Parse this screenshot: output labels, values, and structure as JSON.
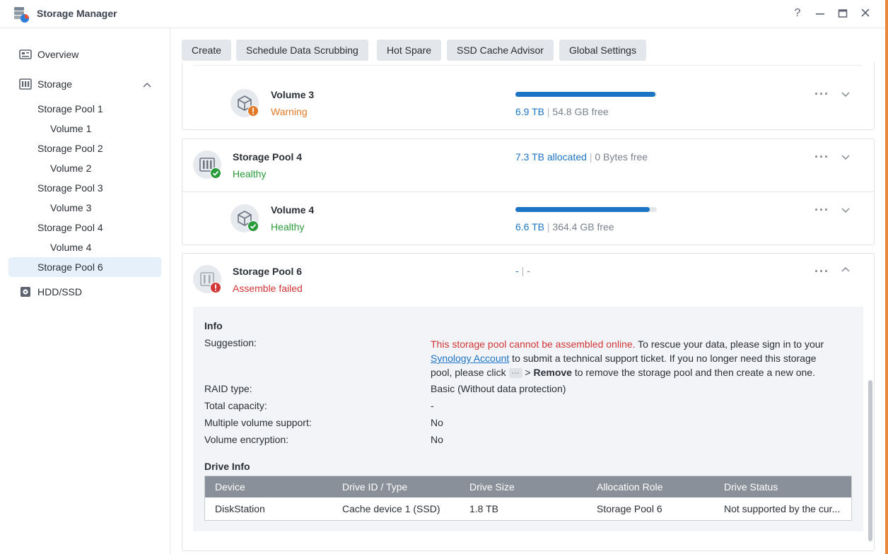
{
  "app": {
    "title": "Storage Manager",
    "window_buttons": {
      "help": "?",
      "minimize": "—",
      "maximize": "□",
      "close": "✕"
    }
  },
  "sidebar": {
    "overview": "Overview",
    "storage": "Storage",
    "items": [
      {
        "label": "Storage Pool 1"
      },
      {
        "label": "Volume 1"
      },
      {
        "label": "Storage Pool 2"
      },
      {
        "label": "Volume 2"
      },
      {
        "label": "Storage Pool 3"
      },
      {
        "label": "Volume 3"
      },
      {
        "label": "Storage Pool 4"
      },
      {
        "label": "Volume 4"
      },
      {
        "label": "Storage Pool 6"
      }
    ],
    "hdd": "HDD/SSD"
  },
  "toolbar": {
    "create": "Create",
    "scrubbing": "Schedule Data Scrubbing",
    "hot_spare": "Hot Spare",
    "cache_advisor": "SSD Cache Advisor",
    "global_settings": "Global Settings"
  },
  "volume3": {
    "name": "Volume 3",
    "status": "Warning",
    "used": "6.9 TB",
    "sep": "|",
    "free": "54.8 GB free",
    "usage": 0.99
  },
  "pool4": {
    "name": "Storage Pool 4",
    "status": "Healthy",
    "allocated": "7.3 TB allocated",
    "sep": "|",
    "free": "0 Bytes free"
  },
  "volume4": {
    "name": "Volume 4",
    "status": "Healthy",
    "used": "6.6 TB",
    "sep": "|",
    "free": "364.4 GB free",
    "usage": 0.95
  },
  "pool6": {
    "name": "Storage Pool 6",
    "status": "Assemble failed",
    "capacity_a": "-",
    "sep": "|",
    "capacity_b": "-",
    "info": {
      "heading": "Info",
      "suggestion_label": "Suggestion:",
      "suggestion_error": "This storage pool cannot be assembled online.",
      "suggestion_1": " To rescue your data, please sign in to your",
      "suggestion_link": "Synology Account",
      "suggestion_2": " to submit a technical support ticket. If you no longer need this storage",
      "suggestion_3": "pool, please click",
      "suggestion_dots": "···",
      "suggestion_4": " > ",
      "suggestion_remove": "Remove",
      "suggestion_5": " to remove the storage pool and then create a new one.",
      "raid_label": "RAID type:",
      "raid_value": "Basic (Without data protection)",
      "capacity_label": "Total capacity:",
      "capacity_value": "-",
      "multi_label": "Multiple volume support:",
      "multi_value": "No",
      "enc_label": "Volume encryption:",
      "enc_value": "No"
    },
    "drive_info": {
      "heading": "Drive Info",
      "columns": [
        "Device",
        "Drive ID / Type",
        "Drive Size",
        "Allocation Role",
        "Drive Status"
      ],
      "rows": [
        [
          "DiskStation",
          "Cache device 1 (SSD)",
          "1.8 TB",
          "Storage Pool 6",
          "Not supported by the cur..."
        ]
      ]
    }
  },
  "colors": {
    "accent": "#1c74c4",
    "warning": "#e17a2b",
    "healthy": "#2a9b3a",
    "error": "#d23636"
  }
}
